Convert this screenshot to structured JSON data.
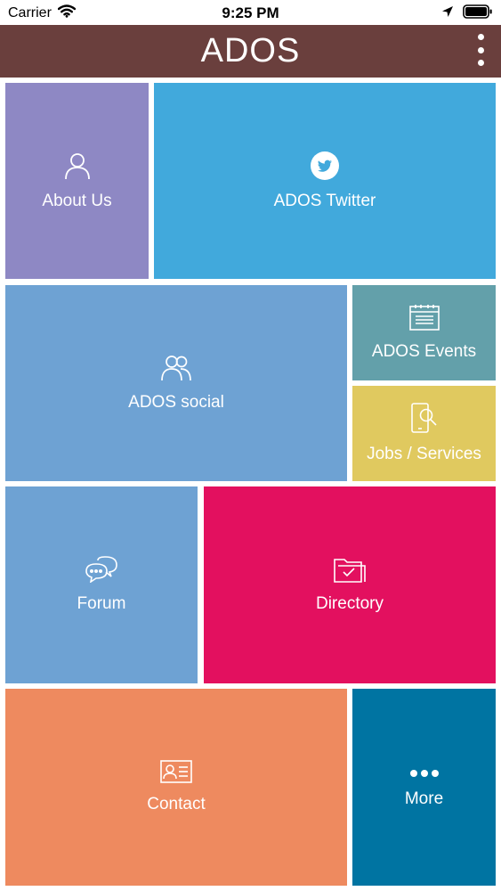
{
  "status_bar": {
    "carrier": "Carrier",
    "time": "9:25 PM",
    "icons": [
      "wifi-icon",
      "location-arrow-icon",
      "battery-icon"
    ]
  },
  "nav": {
    "title": "ADOS",
    "menu_icon": "vertical-ellipsis-icon"
  },
  "colors": {
    "nav_background": "#6a3f3d",
    "about_us": "#8e88c4",
    "twitter": "#41a9dc",
    "social": "#6ea2d3",
    "events": "#63a0aa",
    "jobs": "#e0c95f",
    "forum": "#6ea2d3",
    "directory": "#e3105f",
    "contact": "#ee8a5f",
    "more": "#0074a2"
  },
  "tiles": {
    "about_us": {
      "label": "About Us",
      "icon": "person-icon"
    },
    "twitter": {
      "label": "ADOS Twitter",
      "icon": "twitter-icon"
    },
    "social": {
      "label": "ADOS social",
      "icon": "group-icon"
    },
    "events": {
      "label": "ADOS Events",
      "icon": "calendar-icon"
    },
    "jobs": {
      "label": "Jobs / Services",
      "icon": "phone-search-icon"
    },
    "forum": {
      "label": "Forum",
      "icon": "chat-bubbles-icon"
    },
    "directory": {
      "label": "Directory",
      "icon": "folder-check-icon"
    },
    "contact": {
      "label": "Contact",
      "icon": "contact-card-icon"
    },
    "more": {
      "label": "More",
      "icon": "more-dots-icon"
    }
  }
}
